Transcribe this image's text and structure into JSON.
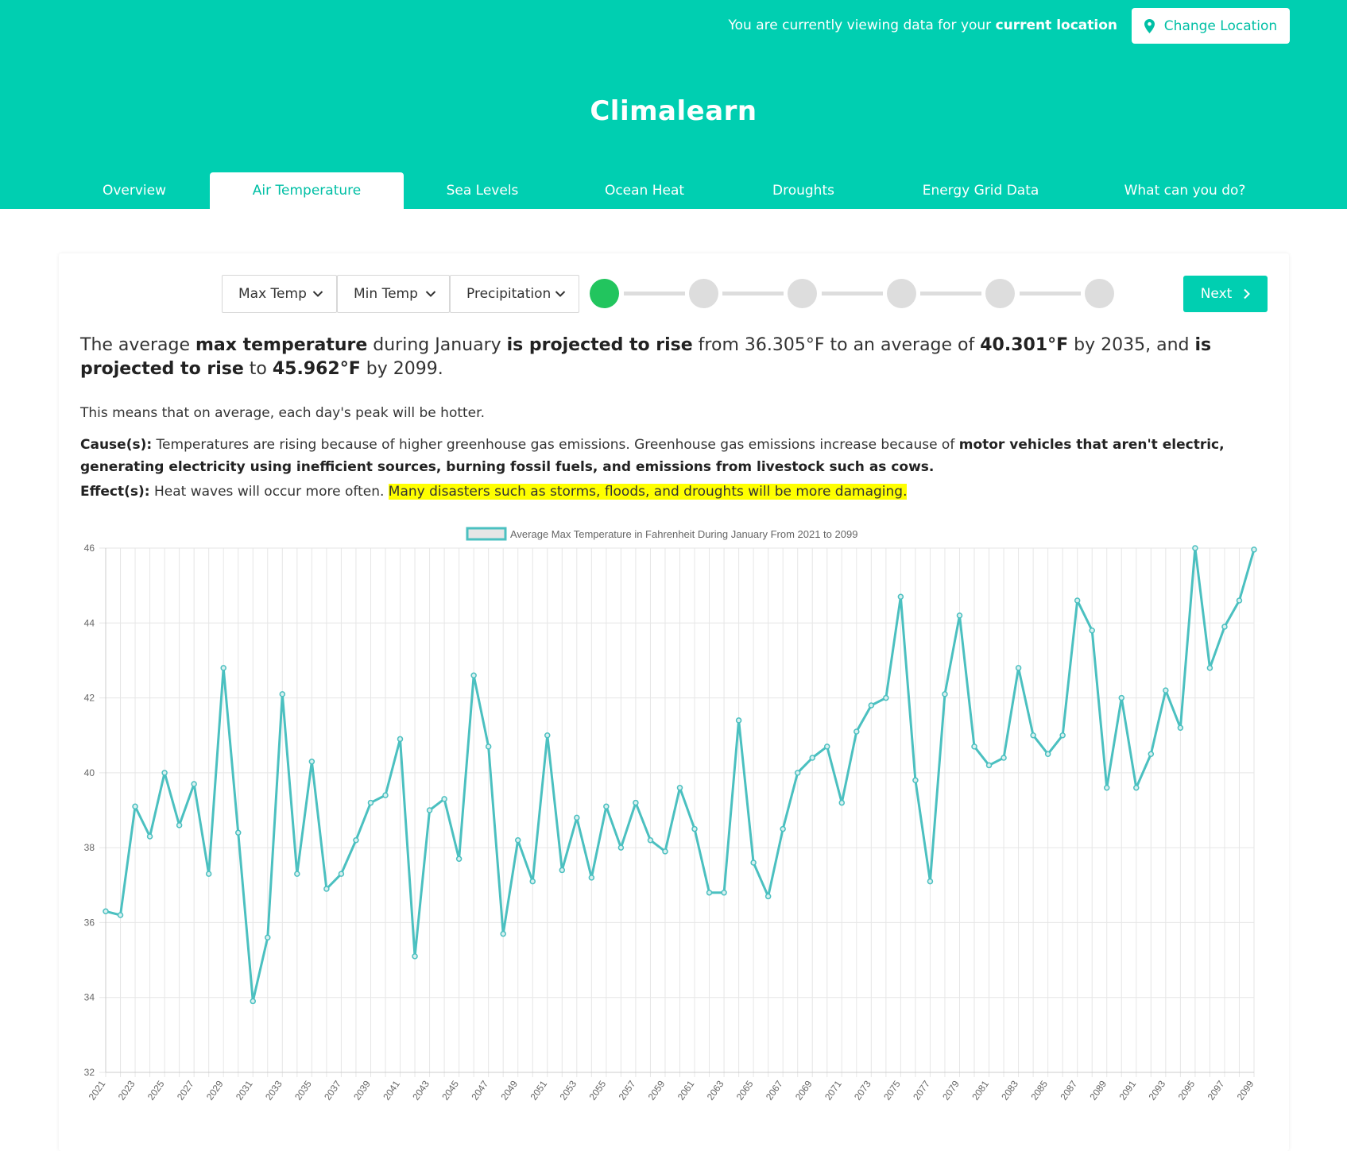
{
  "location_bar": {
    "prefix": "You are currently viewing data for your",
    "emphasis": "current location",
    "change_button": "Change Location",
    "pin_icon": "map-pin-icon"
  },
  "app": {
    "title": "Climalearn"
  },
  "tabs": [
    {
      "label": "Overview",
      "active": false
    },
    {
      "label": "Air Temperature",
      "active": true
    },
    {
      "label": "Sea Levels",
      "active": false
    },
    {
      "label": "Ocean Heat",
      "active": false
    },
    {
      "label": "Droughts",
      "active": false
    },
    {
      "label": "Energy Grid Data",
      "active": false
    },
    {
      "label": "What can you do?",
      "active": false
    }
  ],
  "controls": {
    "dropdowns": [
      "Max Temp",
      "Min Temp",
      "Precipitation"
    ],
    "dropdown_icon": "chevron-down-icon",
    "steps_total": 6,
    "current_step": 1,
    "next_button": "Next",
    "next_icon": "chevron-right-icon"
  },
  "colors": {
    "brand": "#00cfb1",
    "line": "#4bc0c0",
    "step_active": "#22c55e",
    "highlight": "#ffff00"
  },
  "summary": {
    "s1": "The average ",
    "b1": "max temperature",
    "s2": " during January ",
    "b2": "is projected to rise",
    "s3": " from 36.305°F to an average of ",
    "b3": "40.301°F",
    "s4": " by 2035, and ",
    "b4": "is projected to rise",
    "s5": " to ",
    "b5": "45.962°F",
    "s6": " by 2099."
  },
  "explanation": {
    "means": "This means that on average, each day's peak will be hotter.",
    "causes_label": "Cause(s):",
    "causes_text": " Temperatures are rising because of higher greenhouse gas emissions. Greenhouse gas emissions increase because of ",
    "causes_bold": "motor vehicles that aren't electric, generating electricity using inefficient sources, burning fossil fuels, and emissions from livestock such as cows.",
    "effects_label": "Effect(s):",
    "effects_text": " Heat waves will occur more often. ",
    "effects_highlight": "Many disasters such as storms, floods, and droughts will be more damaging."
  },
  "chart_data": {
    "type": "line",
    "title": "",
    "legend": [
      "Average Max Temperature in Fahrenheit During January From 2021 to 2099"
    ],
    "legend_placement": "top-center",
    "xlabel": "",
    "ylabel": "",
    "ylim": [
      32,
      46
    ],
    "yticks": [
      32,
      34,
      36,
      38,
      40,
      42,
      44,
      46
    ],
    "grid": true,
    "x": [
      2021,
      2022,
      2023,
      2024,
      2025,
      2026,
      2027,
      2028,
      2029,
      2030,
      2031,
      2032,
      2033,
      2034,
      2035,
      2036,
      2037,
      2038,
      2039,
      2040,
      2041,
      2042,
      2043,
      2044,
      2045,
      2046,
      2047,
      2048,
      2049,
      2050,
      2051,
      2052,
      2053,
      2054,
      2055,
      2056,
      2057,
      2058,
      2059,
      2060,
      2061,
      2062,
      2063,
      2064,
      2065,
      2066,
      2067,
      2068,
      2069,
      2070,
      2071,
      2072,
      2073,
      2074,
      2075,
      2076,
      2077,
      2078,
      2079,
      2080,
      2081,
      2082,
      2083,
      2084,
      2085,
      2086,
      2087,
      2088,
      2089,
      2090,
      2091,
      2092,
      2093,
      2094,
      2095,
      2096,
      2097,
      2098,
      2099
    ],
    "xtick_labels": [
      "2021",
      "2023",
      "2025",
      "2027",
      "2029",
      "2031",
      "2033",
      "2035",
      "2037",
      "2039",
      "2041",
      "2043",
      "2045",
      "2047",
      "2049",
      "2051",
      "2053",
      "2055",
      "2057",
      "2059",
      "2061",
      "2063",
      "2065",
      "2067",
      "2069",
      "2071",
      "2073",
      "2075",
      "2077",
      "2079",
      "2081",
      "2083",
      "2085",
      "2087",
      "2089",
      "2091",
      "2093",
      "2095",
      "2097",
      "2099"
    ],
    "series": [
      {
        "name": "Average Max Temperature in Fahrenheit During January From 2021 to 2099",
        "values": [
          36.3,
          36.2,
          39.1,
          38.3,
          40.0,
          38.6,
          39.7,
          37.3,
          42.8,
          38.4,
          33.9,
          35.6,
          42.1,
          37.3,
          40.3,
          36.9,
          37.3,
          38.2,
          39.2,
          39.4,
          40.9,
          35.1,
          39.0,
          39.3,
          37.7,
          42.6,
          40.7,
          35.7,
          38.2,
          37.1,
          41.0,
          37.4,
          38.8,
          37.2,
          39.1,
          38.0,
          39.2,
          38.2,
          37.9,
          39.6,
          38.5,
          36.8,
          36.8,
          41.4,
          37.6,
          36.7,
          38.5,
          40.0,
          40.4,
          40.7,
          39.2,
          41.1,
          41.8,
          42.0,
          44.7,
          39.8,
          37.1,
          42.1,
          44.2,
          40.7,
          40.2,
          40.4,
          42.8,
          41.0,
          40.5,
          41.0,
          44.6,
          43.8,
          39.6,
          42.0,
          39.6,
          40.5,
          42.2,
          41.2,
          46.0,
          42.8,
          43.9,
          44.6,
          45.96
        ]
      }
    ]
  }
}
